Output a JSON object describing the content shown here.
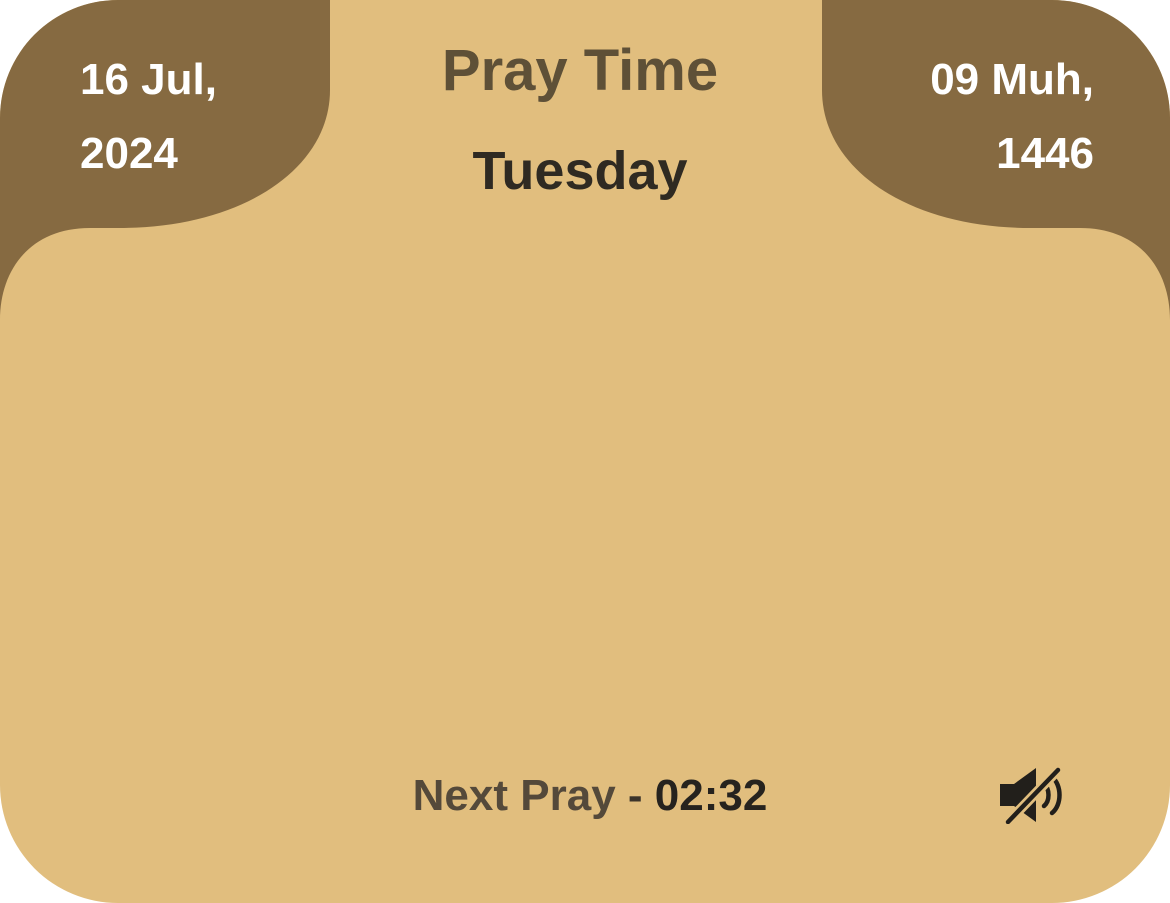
{
  "header": {
    "title": "Pray Time",
    "weekday": "Tuesday",
    "gregorian_date": {
      "line1": "16 Jul,",
      "line2": "2024"
    },
    "hijri_date": {
      "line1": "09 Muh,",
      "line2": "1446"
    }
  },
  "footer": {
    "next_pray_label": "Next Pray",
    "separator": " - ",
    "next_pray_time": "02:32",
    "mute_icon": "speaker-muted-icon"
  },
  "colors": {
    "background": "#e1be7e",
    "header_dark": "#866a41",
    "text_light": "#ffffff",
    "text_title": "#5e5037",
    "text_dark": "#2f2a22"
  }
}
